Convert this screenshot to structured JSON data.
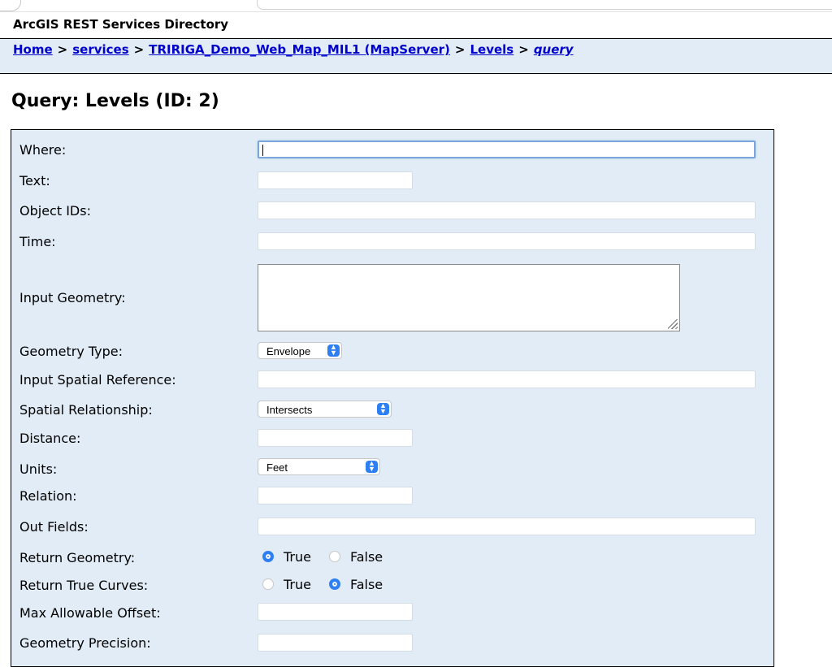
{
  "header": {
    "directory_title": "ArcGIS REST Services Directory"
  },
  "breadcrumb": {
    "home": "Home",
    "services": "services",
    "mapserver": "TRIRIGA_Demo_Web_Map_MIL1 (MapServer)",
    "levels": "Levels",
    "query": "query",
    "separator": ">"
  },
  "page": {
    "title": "Query: Levels (ID: 2)"
  },
  "form": {
    "where": {
      "label": "Where:",
      "value": ""
    },
    "text": {
      "label": "Text:",
      "value": ""
    },
    "object_ids": {
      "label": "Object IDs:",
      "value": ""
    },
    "time": {
      "label": "Time:",
      "value": ""
    },
    "input_geometry": {
      "label": "Input Geometry:",
      "value": ""
    },
    "geometry_type": {
      "label": "Geometry Type:",
      "value": "Envelope"
    },
    "input_spatial_reference": {
      "label": "Input Spatial Reference:",
      "value": ""
    },
    "spatial_relationship": {
      "label": "Spatial Relationship:",
      "value": "Intersects"
    },
    "distance": {
      "label": "Distance:",
      "value": ""
    },
    "units": {
      "label": "Units:",
      "value": "Feet"
    },
    "relation": {
      "label": "Relation:",
      "value": ""
    },
    "out_fields": {
      "label": "Out Fields:",
      "value": ""
    },
    "return_geometry": {
      "label": "Return Geometry:",
      "true_label": "True",
      "false_label": "False",
      "selected": "True"
    },
    "return_true_curves": {
      "label": "Return True Curves:",
      "true_label": "True",
      "false_label": "False",
      "selected": "False"
    },
    "max_allowable_offset": {
      "label": "Max Allowable Offset:",
      "value": ""
    },
    "geometry_precision": {
      "label": "Geometry Precision:",
      "value": ""
    }
  },
  "colors": {
    "form_bg": "#e1ecf6",
    "link": "#0000cc",
    "accent": "#2f7ff4"
  }
}
